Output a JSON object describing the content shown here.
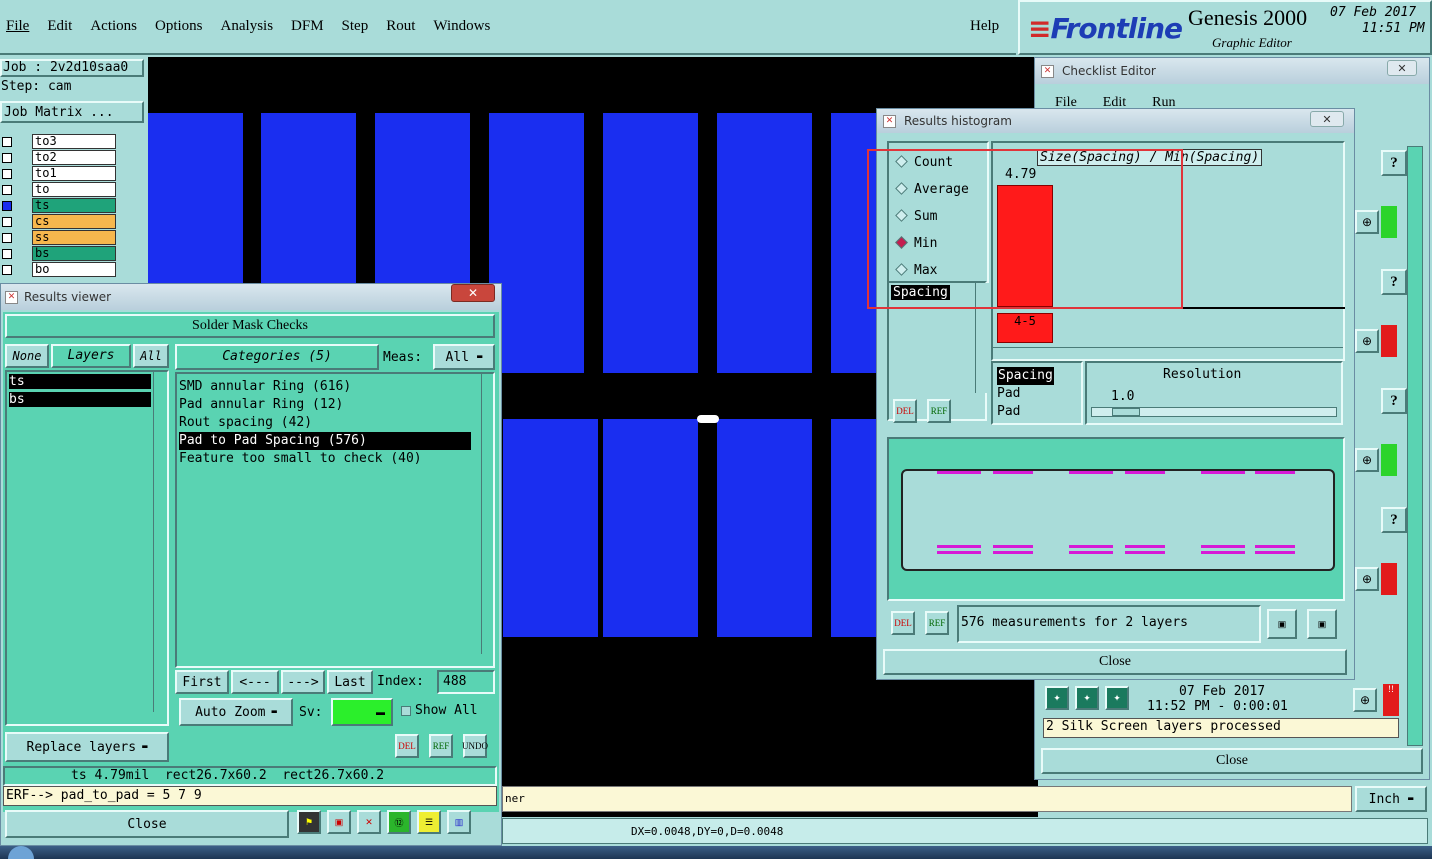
{
  "menu": {
    "items": [
      "File",
      "Edit",
      "Actions",
      "Options",
      "Analysis",
      "DFM",
      "Step",
      "Rout",
      "Windows"
    ],
    "help": "Help"
  },
  "brand": {
    "logo": "Frontline",
    "product": "Genesis 2000",
    "subtitle": "Graphic Editor",
    "date": "07 Feb 2017",
    "time": "11:51 PM"
  },
  "job": {
    "job": "Job : 2v2d10saa0",
    "step": "Step: cam",
    "matrix": "Job Matrix ..."
  },
  "layers": [
    {
      "name": "to3",
      "color": "#ffffff"
    },
    {
      "name": "to2",
      "color": "#ffffff"
    },
    {
      "name": "to1",
      "color": "#ffffff"
    },
    {
      "name": "to",
      "color": "#ffffff"
    },
    {
      "name": "ts",
      "color": "#1fa37a"
    },
    {
      "name": "cs",
      "color": "#f6b74d"
    },
    {
      "name": "ss",
      "color": "#f6b74d"
    },
    {
      "name": "bs",
      "color": "#1fa37a"
    },
    {
      "name": "bo",
      "color": "#ffffff"
    }
  ],
  "results_viewer": {
    "title": "Results viewer",
    "header": "Solder Mask Checks",
    "none": "None",
    "layers_label": "Layers",
    "all": "All",
    "categories_label": "Categories (5)",
    "meas_label": "Meas:",
    "meas_value": "All",
    "layer_items": [
      "ts",
      "bs"
    ],
    "categories": [
      "SMD annular Ring (616)",
      "Pad annular Ring (12)",
      "Rout spacing (42)",
      "Pad to Pad Spacing (576)",
      "Feature too small to check (40)"
    ],
    "first": "First",
    "prev": "<---",
    "next": "--->",
    "last": "Last",
    "index_label": "Index:",
    "index_value": "488",
    "auto_zoom": "Auto Zoom",
    "sv_label": "Sv:",
    "show_all": "Show All",
    "replace_layers": "Replace layers",
    "del": "DEL",
    "ref": "REF",
    "undo": "UNDO",
    "status": "ts 4.79mil  rect26.7x60.2  rect26.7x60.2",
    "erf": "ERF--> pad_to_pad = 5 7 9",
    "close": "Close"
  },
  "histogram": {
    "title": "Results histogram",
    "modes": [
      "Count",
      "Average",
      "Sum",
      "Min",
      "Max"
    ],
    "selected_mode": "Min",
    "list_item": "Spacing",
    "graph_title": "Size(Spacing) / Min(Spacing)",
    "bar_value": "4.79",
    "bar_label": "4-5",
    "attr_items": [
      "Spacing",
      "Pad",
      "Pad"
    ],
    "resolution_label": "Resolution",
    "resolution_value": "1.0",
    "del": "DEL",
    "ref": "REF",
    "measurements": "576 measurements for 2 layers",
    "close": "Close"
  },
  "checklist": {
    "title": "Checklist Editor",
    "menu": [
      "File",
      "Edit",
      "Run"
    ],
    "date": "07 Feb 2017",
    "time": "11:52 PM - 0:00:01",
    "message": "2 Silk Screen layers processed",
    "close": "Close",
    "q": "?"
  },
  "bottom": {
    "coords": "DX=0.0048,DY=0,D=0.0048",
    "units": "Inch",
    "partial": "ner"
  },
  "colors": {
    "bg": "#a9dcd9",
    "panel": "#5ad3b2",
    "pad": "#1a2ef0",
    "bar": "#ff1a1a",
    "highlight": "#e0343a"
  }
}
